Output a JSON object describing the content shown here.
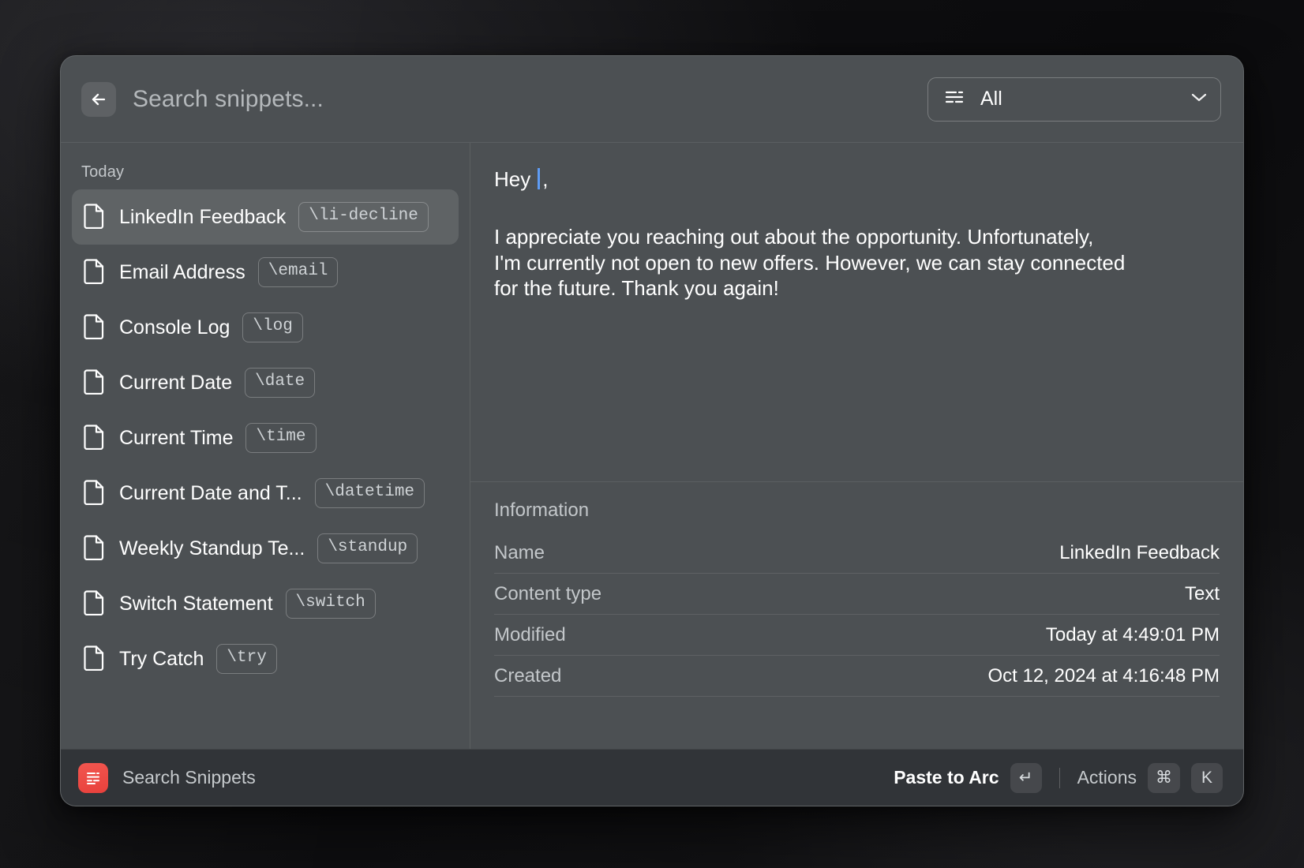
{
  "window": {
    "search": {
      "placeholder": "Search snippets...",
      "value": "",
      "back_icon": "arrow-left-icon"
    },
    "filter": {
      "label": "All",
      "icon": "filter-list-icon",
      "chevron": "chevron-down-icon"
    }
  },
  "sidebar": {
    "section_label": "Today",
    "items": [
      {
        "name": "LinkedIn Feedback",
        "keyword": "\\li-decline",
        "selected": true
      },
      {
        "name": "Email Address",
        "keyword": "\\email",
        "selected": false
      },
      {
        "name": "Console Log",
        "keyword": "\\log",
        "selected": false
      },
      {
        "name": "Current Date",
        "keyword": "\\date",
        "selected": false
      },
      {
        "name": "Current Time",
        "keyword": "\\time",
        "selected": false
      },
      {
        "name": "Current Date and T...",
        "keyword": "\\datetime",
        "selected": false
      },
      {
        "name": "Weekly Standup Te...",
        "keyword": "\\standup",
        "selected": false
      },
      {
        "name": "Switch Statement",
        "keyword": "\\switch",
        "selected": false
      },
      {
        "name": "Try Catch",
        "keyword": "\\try",
        "selected": false
      }
    ]
  },
  "preview": {
    "greeting_before": "Hey",
    "greeting_after": ",",
    "body": "I appreciate you reaching out about the opportunity. Unfortunately, I'm currently not open to new offers. However, we can stay connected for the future. Thank you again!"
  },
  "information": {
    "title": "Information",
    "rows": [
      {
        "key": "Name",
        "value": "LinkedIn Feedback"
      },
      {
        "key": "Content type",
        "value": "Text"
      },
      {
        "key": "Modified",
        "value": "Today at 4:49:01 PM"
      },
      {
        "key": "Created",
        "value": "Oct 12, 2024 at 4:16:48 PM"
      }
    ]
  },
  "footer": {
    "app_name": "Search Snippets",
    "app_icon": "snippets-app-icon",
    "primary_action": {
      "label": "Paste to Arc",
      "key": "↵"
    },
    "secondary_action": {
      "label": "Actions",
      "key_modifier": "⌘",
      "key_letter": "K"
    }
  },
  "colors": {
    "window_bg": "#4c5053",
    "footer_bg": "#313438",
    "accent_red": "#e8413c",
    "caret_blue": "#5e9cf5"
  }
}
